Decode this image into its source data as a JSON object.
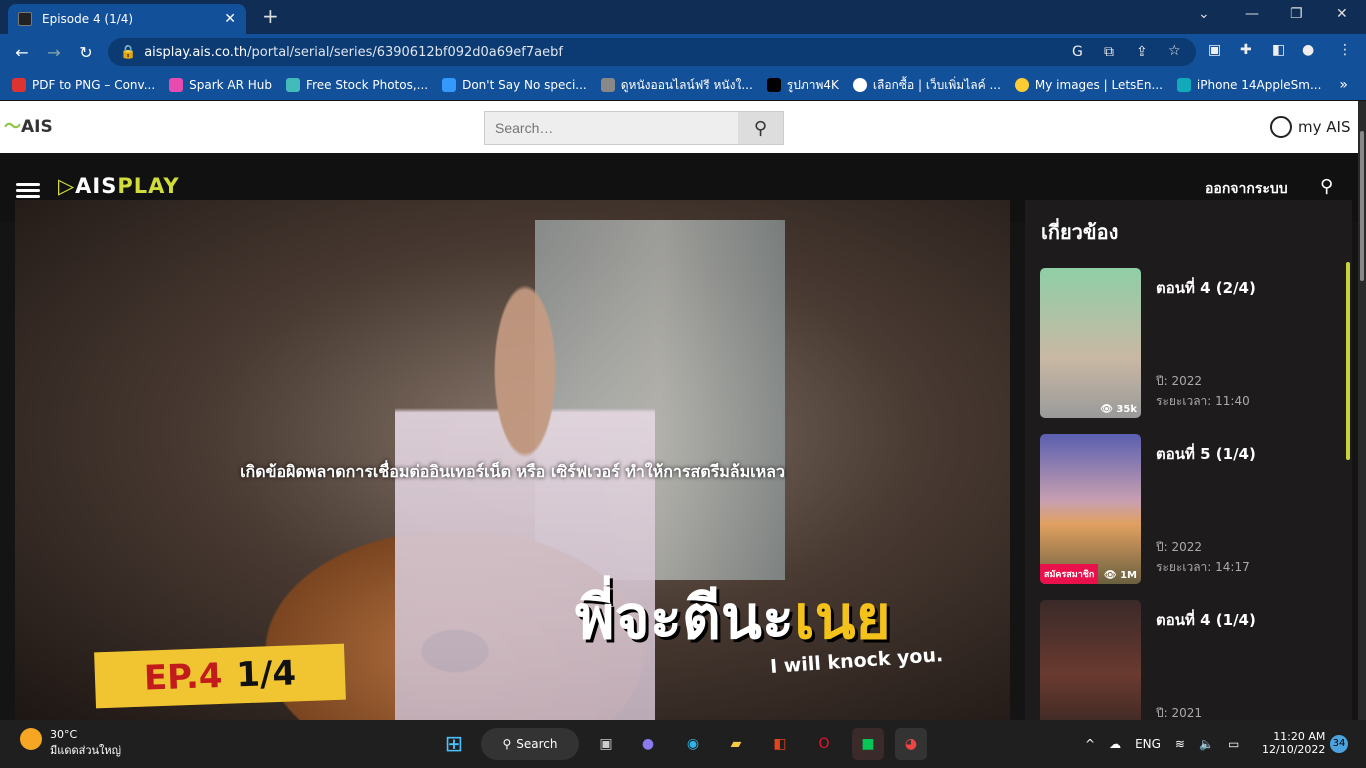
{
  "browser": {
    "tab_title": "Episode 4 (1/4)",
    "new_tab": "+",
    "url_host": "aisplay.ais.co.th",
    "url_path": "/portal/serial/series/6390612bf092d0a69ef7aebf",
    "bookmarks": [
      "PDF to PNG – Conv...",
      "Spark AR Hub",
      "Free Stock Photos,...",
      "Don't Say No speci...",
      "ดูหนังออนไลน์ฟรี หนังใ...",
      "รูปภาพ4K",
      "เลือกซื้อ | เว็บเพิ่มไลค์ ...",
      "My images | LetsEn...",
      "iPhone 14AppleSm..."
    ],
    "more": "»"
  },
  "ais": {
    "logo": "AIS",
    "search_placeholder": "Search…",
    "account": "my AIS"
  },
  "nav": {
    "logo_ais": "AIS",
    "logo_play": "PLAY",
    "logout": "ออกจากระบบ"
  },
  "player": {
    "error": "เกิดข้อผิดพลาดการเชื่อมต่ออินเทอร์เน็ต หรือ เซิร์ฟเวอร์ ทำให้การสตรีมล้มเหลว",
    "ep_badge": "EP.4",
    "ep_part": "1/4",
    "show_title_a": "พี่จะตีนะ",
    "show_title_b": "เนย",
    "tagline": "I will knock you."
  },
  "related": {
    "heading": "เกี่ยวข้อง",
    "items": [
      {
        "title": "ตอนที่ 4 (2/4)",
        "year": "ปี: 2022",
        "duration": "ระยะเวลา: 11:40",
        "views": "35k"
      },
      {
        "title": "ตอนที่ 5 (1/4)",
        "year": "ปี: 2022",
        "duration": "ระยะเวลา: 14:17",
        "views": "1M",
        "badge": "สมัครสมาชิก"
      },
      {
        "title": "ตอนที่ 4 (1/4)",
        "year": "ปี: 2021"
      }
    ]
  },
  "taskbar": {
    "temp": "30°C",
    "weather": "มีแดดส่วนใหญ่",
    "search": "Search",
    "lang": "ENG",
    "time": "11:20 AM",
    "date": "12/10/2022",
    "notifications": "34"
  }
}
